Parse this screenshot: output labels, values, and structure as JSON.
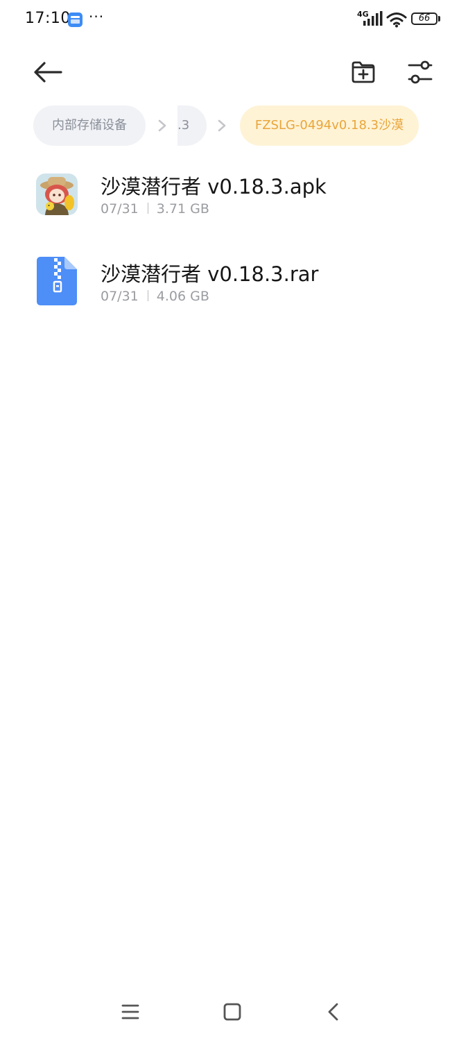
{
  "status_bar": {
    "time": "17:10",
    "app_icon": "calendar-app-icon",
    "more": "···",
    "network": "4G",
    "battery": "66"
  },
  "toolbar": {
    "back_icon": "arrow-left-icon",
    "new_folder_icon": "folder-plus-icon",
    "filter_icon": "sliders-icon"
  },
  "breadcrumb": {
    "root": "内部存储设备",
    "middle": ".3",
    "current": "FZSLG-0494v0.18.3沙漠",
    "separator_icon": "chevron-right-icon"
  },
  "files": [
    {
      "name": "沙漠潜行者 v0.18.3.apk",
      "date": "07/31",
      "size": "3.71 GB",
      "icon": "apk-app-icon"
    },
    {
      "name": "沙漠潜行者 v0.18.3.rar",
      "date": "07/31",
      "size": "4.06 GB",
      "icon": "zip-archive-icon"
    }
  ],
  "nav_bar": {
    "menu_icon": "menu-icon",
    "home_icon": "home-square-icon",
    "back_icon": "back-chevron-icon"
  },
  "colors": {
    "accent_crumb_bg": "#fff3d6",
    "accent_crumb_text": "#e9a53a",
    "crumb_bg": "#f1f2f6",
    "archive_blue": "#4d8ef7"
  }
}
